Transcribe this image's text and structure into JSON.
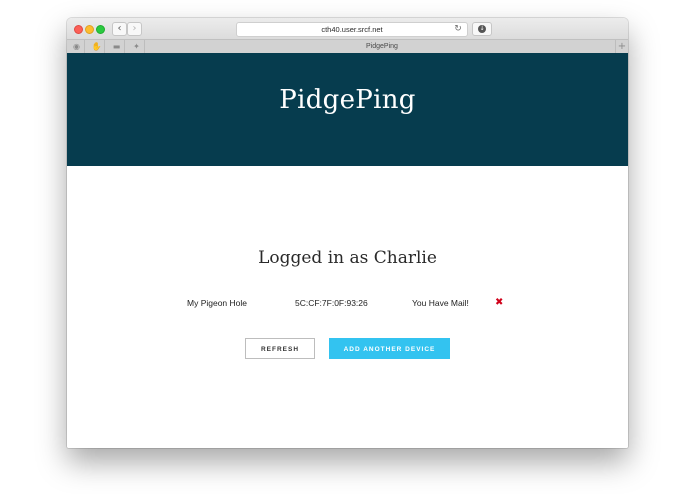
{
  "browser": {
    "url": "cth40.user.srcf.net",
    "tab_title": "PidgePing",
    "nav_back_glyph": "‹",
    "nav_forward_glyph": "›",
    "reload_glyph": "↻",
    "download_glyph": "↓",
    "new_tab_glyph": "+",
    "favorites": [
      {
        "icon": "messenger-icon",
        "glyph": "◉"
      },
      {
        "icon": "hand-icon",
        "glyph": "✋"
      },
      {
        "icon": "dash-icon",
        "glyph": "▬"
      },
      {
        "icon": "twitter-icon",
        "glyph": "✦"
      }
    ]
  },
  "header": {
    "brand": "PidgePing",
    "background_color": "#063c4e"
  },
  "main": {
    "logged_in_text": "Logged in as Charlie",
    "devices": [
      {
        "name": "My Pigeon Hole",
        "mac": "5C:CF:7F:0F:93:26",
        "status": "You Have Mail!",
        "delete_glyph": "✖"
      }
    ],
    "refresh_label": "REFRESH",
    "add_device_label": "ADD ANOTHER DEVICE",
    "accent_color": "#33c3f0",
    "delete_color": "#d0021b"
  }
}
